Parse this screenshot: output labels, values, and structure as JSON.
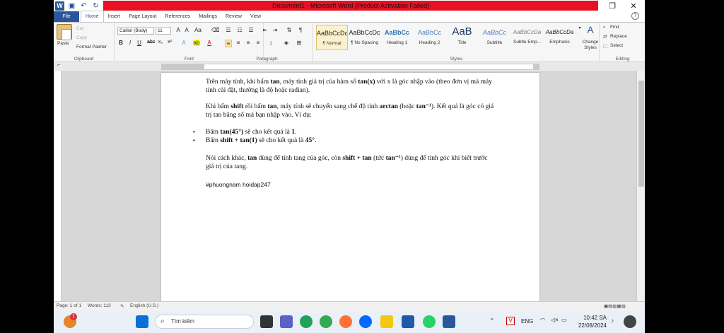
{
  "window": {
    "title": "Document1 - Microsoft Word (Product Activation Failed)"
  },
  "tabs": [
    "File",
    "Home",
    "Insert",
    "Page Layout",
    "References",
    "Mailings",
    "Review",
    "View"
  ],
  "ribbon": {
    "clipboard": {
      "paste": "Paste",
      "cut": "Cut",
      "copy": "Copy",
      "format_painter": "Format Painter",
      "label": "Clipboard"
    },
    "font": {
      "family": "Calibri (Body)",
      "size": "11",
      "label": "Font"
    },
    "paragraph": {
      "label": "Paragraph"
    },
    "styles": {
      "label": "Styles",
      "items": [
        {
          "preview": "AaBbCcDc",
          "name": "¶ Normal"
        },
        {
          "preview": "AaBbCcDc",
          "name": "¶ No Spacing"
        },
        {
          "preview": "AaBbCc",
          "name": "Heading 1"
        },
        {
          "preview": "AaBbCc",
          "name": "Heading 2"
        },
        {
          "preview": "AaB",
          "name": "Title"
        },
        {
          "preview": "AaBbCc",
          "name": "Subtitle"
        },
        {
          "preview": "AaBbCcDa",
          "name": "Subtle Emp..."
        },
        {
          "preview": "AaBbCcDa",
          "name": "Emphasis"
        }
      ],
      "change_styles": "Change Styles"
    },
    "editing": {
      "find": "Find",
      "replace": "Replace",
      "select": "Select",
      "label": "Editing"
    }
  },
  "document": {
    "p1_a": "Trên máy tính, khi bấm",
    "p1_tan": "tan",
    "p1_b": ", máy tính giá trị của hàm số",
    "p1_tanx": "tan(x)",
    "p1_c": "với x là góc nhập vào (theo đơn vị mà máy tính cài đặt, thường là độ hoặc radian).",
    "p2_a": "Khi bấm",
    "p2_shift": "shift",
    "p2_b": "rồi bấm",
    "p2_tan": "tan",
    "p2_c": ", máy tính sẽ chuyển sang chế độ tính",
    "p2_arctan": "arctan",
    "p2_d": "(hoặc",
    "p2_taninv": "tan⁻¹",
    "p2_e": "). Kết quả là góc có giá trị tan bằng số mà bạn nhập vào. Ví dụ:",
    "b1_a": "Bấm",
    "b1_expr": "tan(45°)",
    "b1_b": "sẽ cho kết quả là",
    "b1_res": "1",
    "b2_a": "Bấm",
    "b2_expr": "shift + tan(1)",
    "b2_b": "sẽ cho kết quả là",
    "b2_res": "45°",
    "p3_a": "Nói cách khác,",
    "p3_tan": "tan",
    "p3_b": "dùng để tính tang của góc, còn",
    "p3_shift": "shift + tan",
    "p3_c": "(tức",
    "p3_taninv": "tan⁻¹",
    "p3_d": ") dùng để tính góc khi biết trước giá trị của tang.",
    "hashtag": "#phuongnam hoidap247"
  },
  "status": {
    "page": "Page: 1 of 1",
    "words": "Words: 113",
    "language": "English (U.S.)"
  },
  "taskbar": {
    "search_placeholder": "Tìm kiếm",
    "lang": "ENG",
    "time": "10:42 SA",
    "date": "22/08/2024",
    "badge_count": "1"
  },
  "colors": {
    "title_red": "#e81123",
    "word_blue": "#2b579a"
  }
}
